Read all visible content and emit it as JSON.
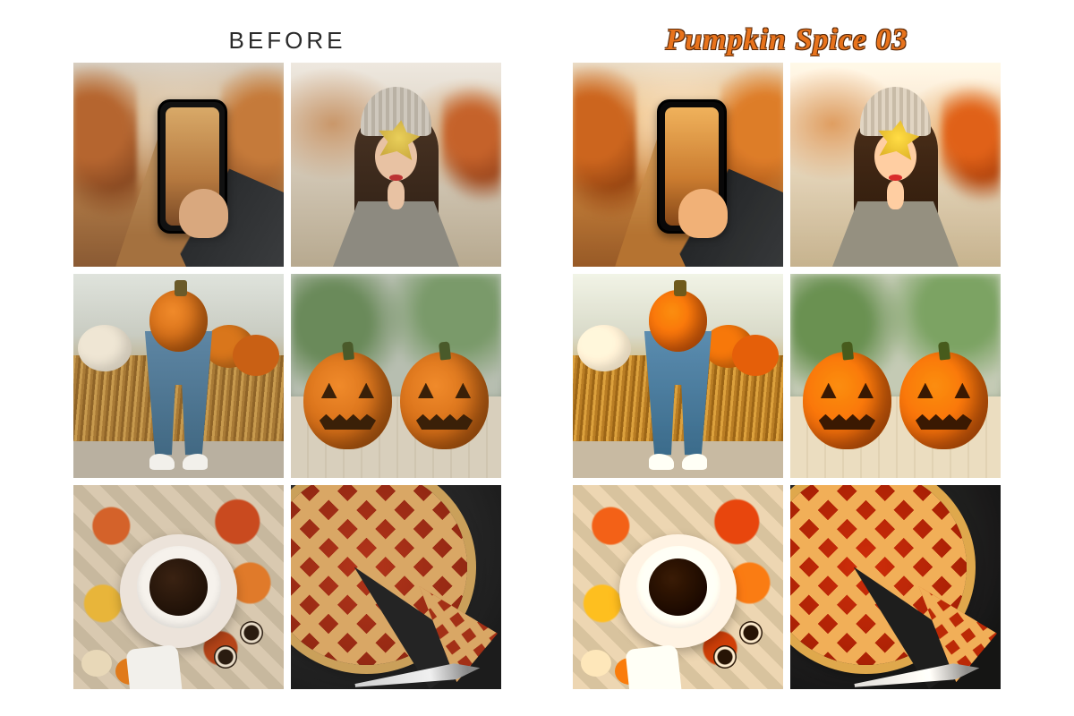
{
  "panels": {
    "before": {
      "title": "BEFORE"
    },
    "after": {
      "title": "Pumpkin Spice 03"
    }
  },
  "tiles": [
    {
      "name": "phone-autumn-path",
      "desc": "hand holding smartphone photographing autumn forest path"
    },
    {
      "name": "woman-leaf-face",
      "desc": "woman in grey beanie and coat holding yellow maple leaf over face"
    },
    {
      "name": "jeans-pumpkin-hay",
      "desc": "person in blue jeans and white sneakers holding large pumpkin, standing on hay bale with more pumpkins"
    },
    {
      "name": "jack-o-lanterns",
      "desc": "two carved jack-o-lantern pumpkins on weathered wooden picnic table"
    },
    {
      "name": "coffee-flatlay",
      "desc": "top-down coffee cup on saucer surrounded by autumn leaves, mini pumpkins, cookies and a phone"
    },
    {
      "name": "lattice-pie",
      "desc": "lattice-crust fruit pie on dark slate board with one slice cut and pulled out, knife beside"
    }
  ],
  "colors": {
    "accent_orange": "#e8731c",
    "accent_outline": "#5a2a0a",
    "heading_grey": "#2a2a2a"
  }
}
